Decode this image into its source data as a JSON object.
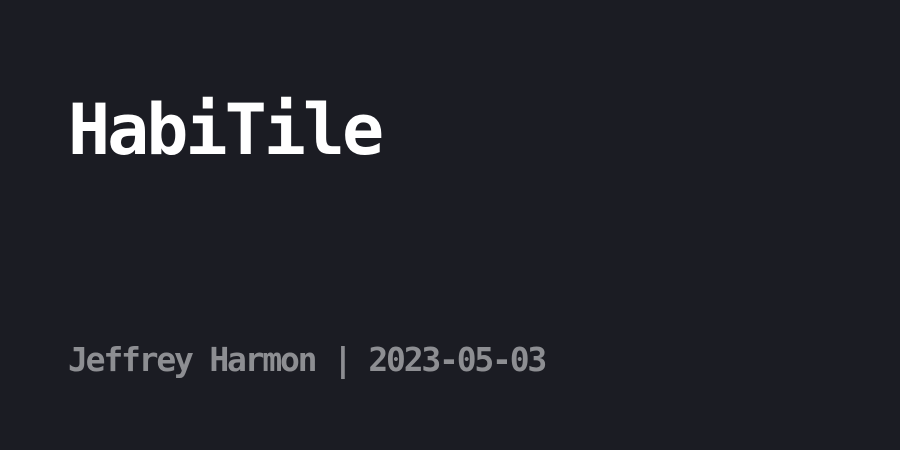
{
  "card": {
    "title": "HabiTile",
    "author": "Jeffrey Harmon",
    "separator": " | ",
    "date": "2023-05-03"
  },
  "colors": {
    "background": "#1b1c23",
    "title": "#ffffff",
    "byline": "#8d8e92"
  }
}
